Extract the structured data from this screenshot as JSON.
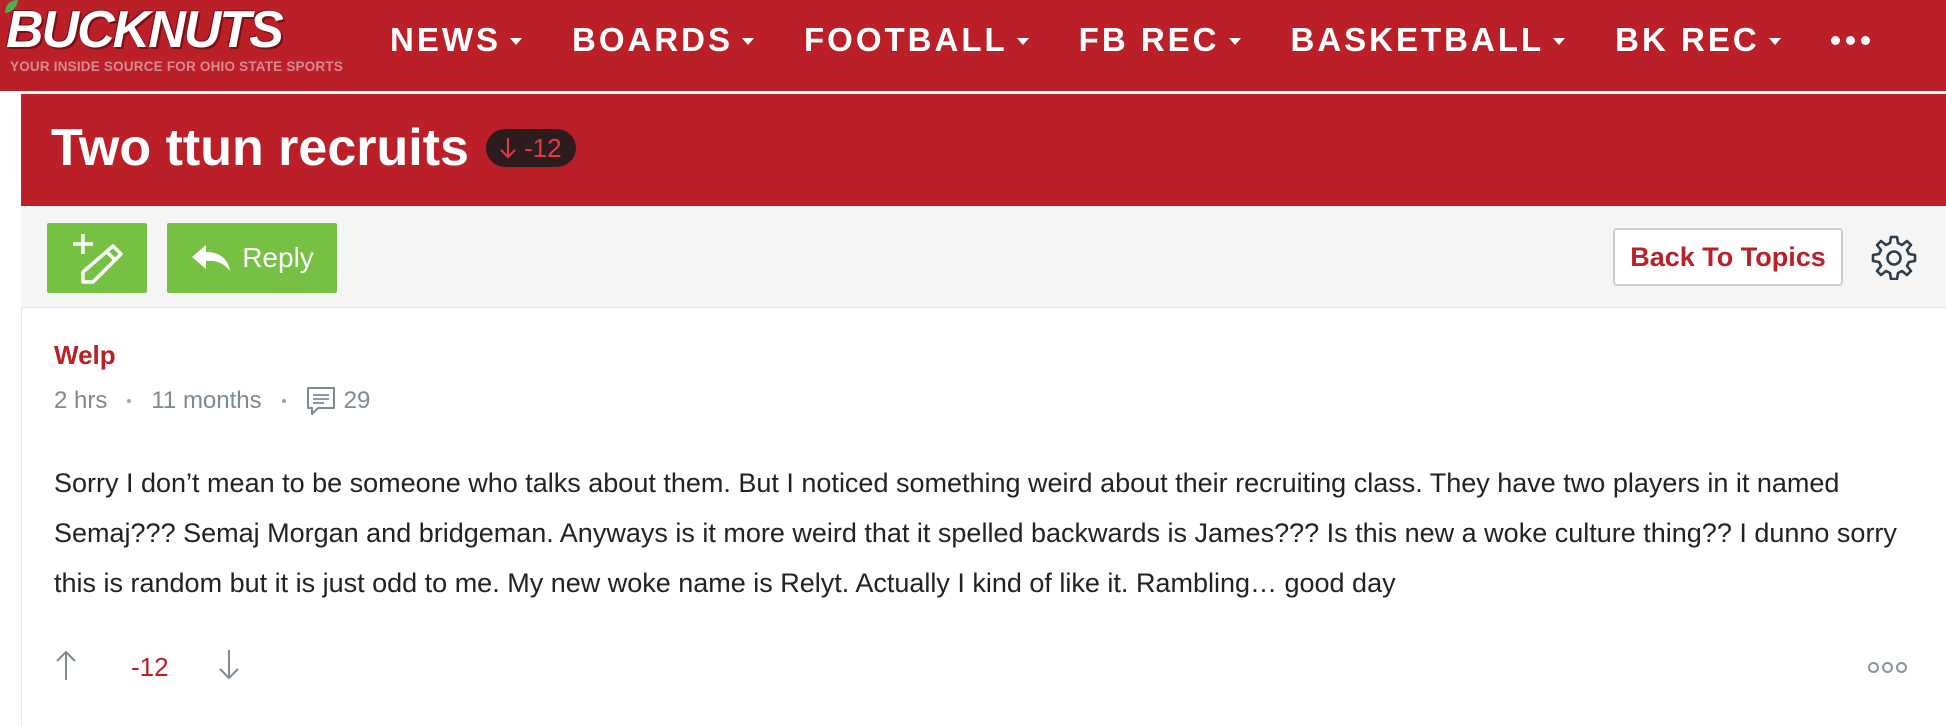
{
  "site": {
    "logo_text": "BUCKNUTS",
    "tagline": "YOUR INSIDE SOURCE FOR OHIO STATE SPORTS",
    "brand_color": "#bb1f28"
  },
  "nav": {
    "items": [
      {
        "label": "NEWS"
      },
      {
        "label": "BOARDS"
      },
      {
        "label": "FOOTBALL"
      },
      {
        "label": "FB REC"
      },
      {
        "label": "BASKETBALL"
      },
      {
        "label": "BK REC"
      }
    ],
    "more_icon": "ellipsis-icon"
  },
  "thread": {
    "title": "Two ttun recruits",
    "score": "-12",
    "score_icon": "arrow-down-icon"
  },
  "toolbar": {
    "new_topic_icon": "pen-plus-icon",
    "reply_label": "Reply",
    "reply_icon": "reply-arrow-icon",
    "back_label": "Back To Topics",
    "settings_icon": "gear-icon",
    "accent_color": "#76c043"
  },
  "post": {
    "author": "Welp",
    "time_ago": "2 hrs",
    "member_age": "11 months",
    "comment_count": "29",
    "body": "Sorry I don’t mean to be someone who talks about them. But I noticed something weird about their recruiting class. They have two players in it named Semaj??? Semaj Morgan and bridgeman. Anyways is it more weird that it spelled backwards is James??? Is this new a woke culture thing?? I dunno sorry this is random but it is just odd to me. My new woke name is Relyt. Actually I kind of like it. Rambling… good day",
    "vote_count": "-12",
    "more_icon": "more-options-icon"
  }
}
